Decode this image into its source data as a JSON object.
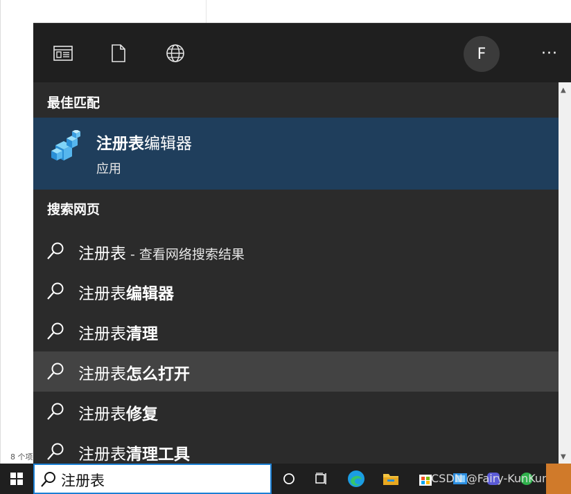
{
  "background": {
    "status_text": "8 个项"
  },
  "topbar": {
    "icons": [
      "apps-icon",
      "document-icon",
      "globe-icon"
    ],
    "avatar_letter": "F",
    "more_label": "···"
  },
  "best_match": {
    "section_label": "最佳匹配",
    "title_bold": "注册表",
    "title_rest": "编辑器",
    "subtitle": "应用"
  },
  "web_search": {
    "section_label": "搜索网页",
    "items": [
      {
        "prefix": "注册表",
        "bold": "",
        "suffix": " - 查看网络搜索结果"
      },
      {
        "prefix": "注册表",
        "bold": "编辑器",
        "suffix": ""
      },
      {
        "prefix": "注册表",
        "bold": "清理",
        "suffix": ""
      },
      {
        "prefix": "注册表",
        "bold": "怎么打开",
        "suffix": ""
      },
      {
        "prefix": "注册表",
        "bold": "修复",
        "suffix": ""
      },
      {
        "prefix": "注册表",
        "bold": "清理工具",
        "suffix": ""
      }
    ]
  },
  "taskbar": {
    "search_value": "注册表",
    "watermark": "CSDN @Fairy-KunKun"
  },
  "colors": {
    "panel_bg": "#2b2b2b",
    "topbar_bg": "#1f1f1f",
    "selected_bg": "#1f3e5c",
    "hover_bg": "#434343",
    "accent": "#1a7fd4"
  }
}
